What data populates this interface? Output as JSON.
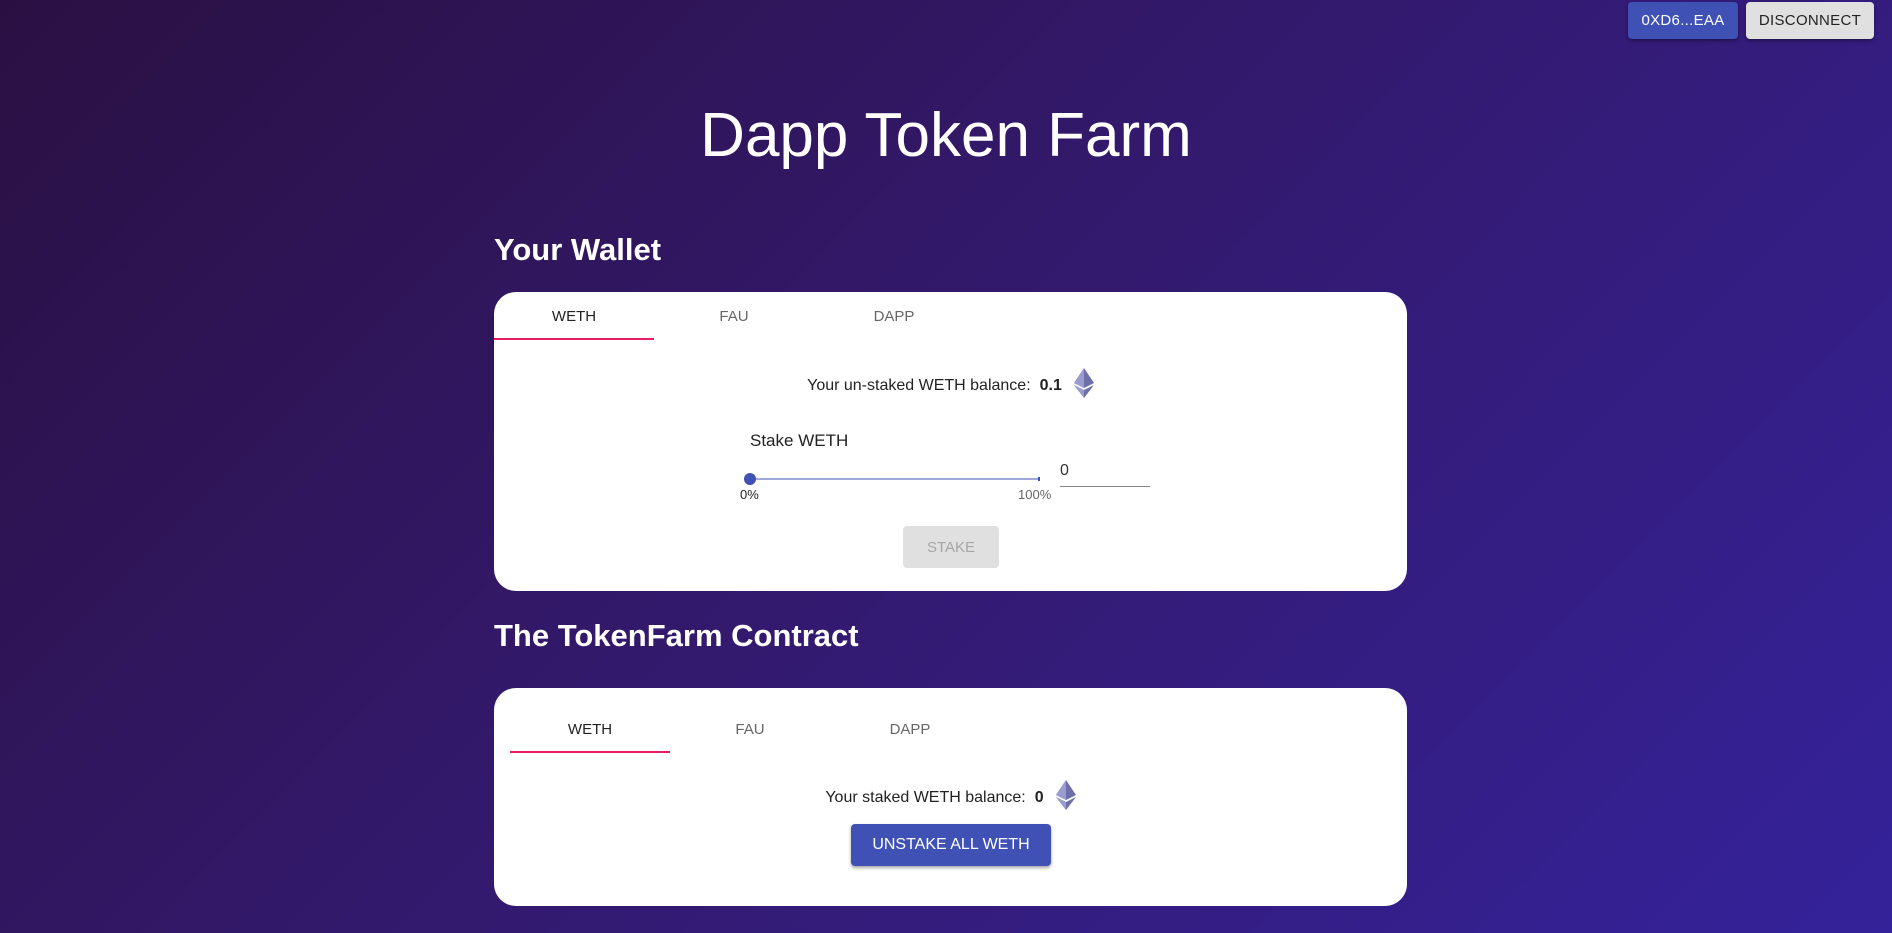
{
  "header": {
    "address_label": "0XD6...EAA",
    "disconnect_label": "DISCONNECT"
  },
  "page_title": "Dapp Token Farm",
  "wallet": {
    "heading": "Your Wallet",
    "tabs": [
      "WETH",
      "FAU",
      "DAPP"
    ],
    "active_tab": "WETH",
    "balance_label": "Your un-staked WETH balance:",
    "balance_value": "0.1",
    "stake_label": "Stake WETH",
    "slider_value_percent": 0,
    "slider_min_label": "0%",
    "slider_max_label": "100%",
    "amount_input_value": "0",
    "stake_button_label": "STAKE"
  },
  "contract": {
    "heading": "The TokenFarm Contract",
    "tabs": [
      "WETH",
      "FAU",
      "DAPP"
    ],
    "active_tab": "WETH",
    "balance_label": "Your staked WETH balance:",
    "balance_value": "0",
    "unstake_button_label": "UNSTAKE ALL WETH"
  },
  "colors": {
    "primary": "#3f51b5",
    "tab_indicator": "#e91e63",
    "disabled_button": "#e0e0e0"
  },
  "icons": {
    "token_icon": "ethereum-icon"
  }
}
